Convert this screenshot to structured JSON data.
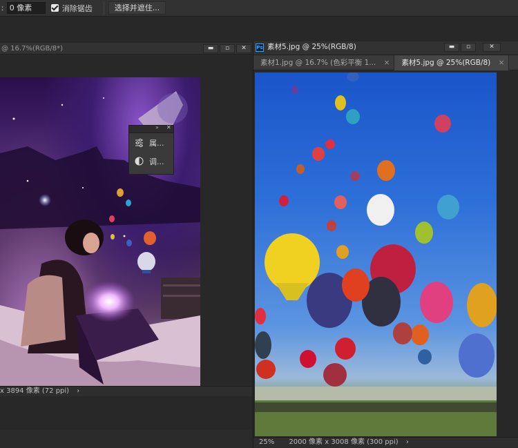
{
  "options_bar": {
    "label_fragment": "ː",
    "feather_value": "0 像素",
    "antialias_label": "消除锯齿",
    "select_mask_label": "选择并遮住..."
  },
  "left_window": {
    "title": "@ 16.7%(RGB/8*)",
    "status": "x 3894 像素 (72 ppi)",
    "status_arrow": "›"
  },
  "mini_panel": {
    "collapse_glyph": "»",
    "close_glyph": "✕",
    "items": [
      {
        "label": "属...",
        "icon": "properties-sliders-icon"
      },
      {
        "label": "调...",
        "icon": "adjustments-icon"
      }
    ]
  },
  "right_window": {
    "ps_badge": "Ps",
    "title": "素材5.jpg @ 25%(RGB/8)",
    "tabs": [
      {
        "label": "素材1.jpg @ 16.7% (色彩平衡 1...",
        "close": "×"
      },
      {
        "label": "素材5.jpg @ 25%(RGB/8)",
        "close": "×"
      }
    ],
    "zoom": "25%",
    "status": "2000 像素 x 3008 像素 (300 ppi)",
    "status_arrow": "›"
  },
  "window_buttons": {
    "minimize": "▬",
    "maximize": "▫",
    "close": "✕"
  }
}
